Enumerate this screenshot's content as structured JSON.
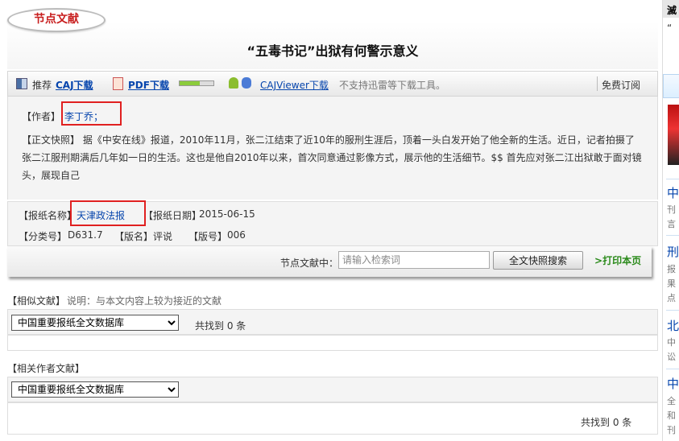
{
  "section_label": "节点文献",
  "title": "“五毒书记”出狱有何警示意义",
  "toolbar": {
    "recommend": "推荐",
    "caj_download": "CAJ下载",
    "pdf_download": "PDF下载",
    "pdf_progress": 0.6,
    "cajviewer_download": "CAJViewer下载",
    "note": "不支持迅雷等下载工具。",
    "subscribe": "免费订阅"
  },
  "author": {
    "label": "【作者】",
    "name": "李丁乔；"
  },
  "abstract": {
    "label": "【正文快照】",
    "text": "据《中安在线》报道，2010年11月，张二江结束了近10年的服刑生涯后，顶着一头白发开始了他全新的生活。近日，记者拍摄了张二江服刑期满后几年如一日的生活。这也是他自2010年以来，首次同意通过影像方式，展示他的生活细节。$$ 首先应对张二江出狱敢于面对镜头，展现自己"
  },
  "paper": {
    "name_label": "【报纸名称】",
    "name": "天津政法报",
    "date_label": "【报纸日期】",
    "date": "2015-06-15",
    "class_label": "【分类号】",
    "class_no": "D631.7",
    "edition_label": "【版名】",
    "edition": "评说",
    "page_label": "【版号】",
    "page": "006"
  },
  "search": {
    "label": "节点文献中：",
    "placeholder": "请输入检索词",
    "button": "全文快照搜索",
    "print": "打印本页",
    "print_prefix": ">"
  },
  "similar": {
    "title": "【相似文献】",
    "desc": "说明：与本文内容上较为接近的文献",
    "db_option": "中国重要报纸全文数据库",
    "count": "共找到 0 条"
  },
  "related_authors": {
    "title": "【相关作者文献】",
    "db_option": "中国重要报纸全文数据库",
    "count": "共找到 0 条"
  },
  "sidebar": {
    "top": "滅",
    "top2": "“",
    "items": [
      {
        "head": "中",
        "lines": [
          "刊",
          "言"
        ]
      },
      {
        "head": "刑",
        "lines": [
          "报",
          "果",
          "点"
        ]
      },
      {
        "head": "北",
        "lines": [
          "中",
          "讼"
        ]
      },
      {
        "head": "中",
        "lines": [
          "全",
          "和",
          "刊"
        ]
      }
    ]
  },
  "colors": {
    "highlight_box": "#e02020",
    "link": "#0645ad",
    "label_red": "#c81e1e",
    "print_green": "#2a8a1a"
  }
}
